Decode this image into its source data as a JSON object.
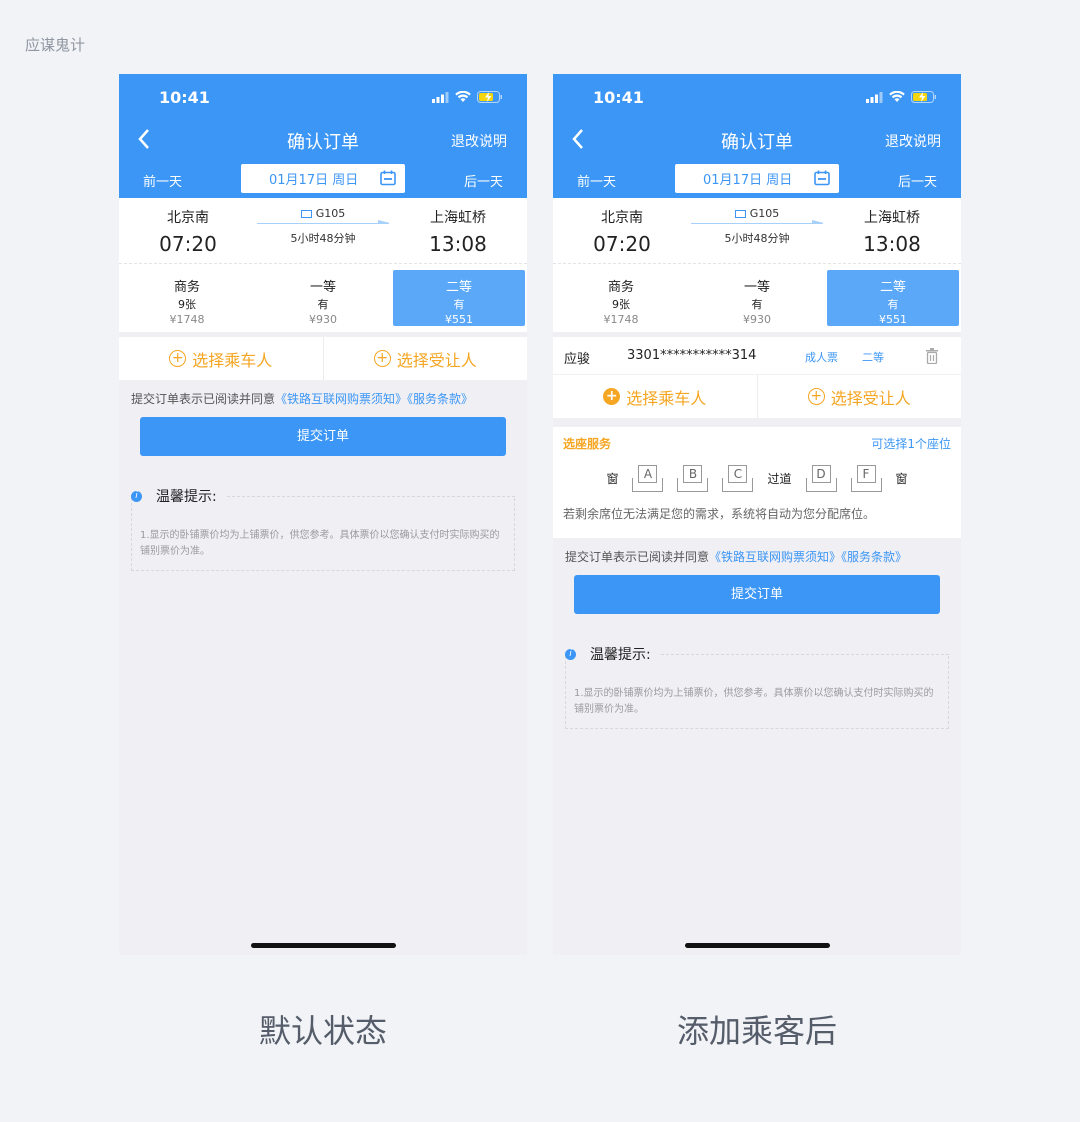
{
  "brand": "应谋鬼计",
  "status": {
    "time": "10:41"
  },
  "nav": {
    "title": "确认订单",
    "right": "退改说明",
    "prev_day": "前一天",
    "next_day": "后一天",
    "date": "01月17日 周日"
  },
  "train": {
    "from": "北京南",
    "to": "上海虹桥",
    "depart": "07:20",
    "arrive": "13:08",
    "number": "G105",
    "duration": "5小时48分钟"
  },
  "seats": [
    {
      "name": "商务",
      "avail": "9张",
      "price": "¥1748"
    },
    {
      "name": "一等",
      "avail": "有",
      "price": "¥930"
    },
    {
      "name": "二等",
      "avail": "有",
      "price": "¥551"
    }
  ],
  "actions": {
    "choose_passenger": "选择乘车人",
    "choose_beneficiary": "选择受让人",
    "plus": "+"
  },
  "agree": {
    "prefix": "提交订单表示已阅读并同意",
    "link": "《铁路互联网购票须知》《服务条款》"
  },
  "submit": "提交订单",
  "tips": {
    "title": "温馨提示:",
    "content": "1.显示的卧铺票价均为上铺票价，供您参考。具体票价以您确认支付时实际购买的铺别票价为准。",
    "info": "i"
  },
  "passenger": {
    "name": "应骏",
    "id": "3301***********314",
    "type": "成人票",
    "seat": "二等"
  },
  "seat_service": {
    "title": "选座服务",
    "hint": "可选择1个座位",
    "window": "窗",
    "aisle": "过道",
    "letters": [
      "A",
      "B",
      "C",
      "D",
      "F"
    ],
    "note": "若剩余席位无法满足您的需求，系统将自动为您分配席位。"
  },
  "captions": {
    "left": "默认状态",
    "right": "添加乘客后"
  },
  "colors": {
    "primary": "#3c96f5",
    "accent": "#f5a623"
  }
}
